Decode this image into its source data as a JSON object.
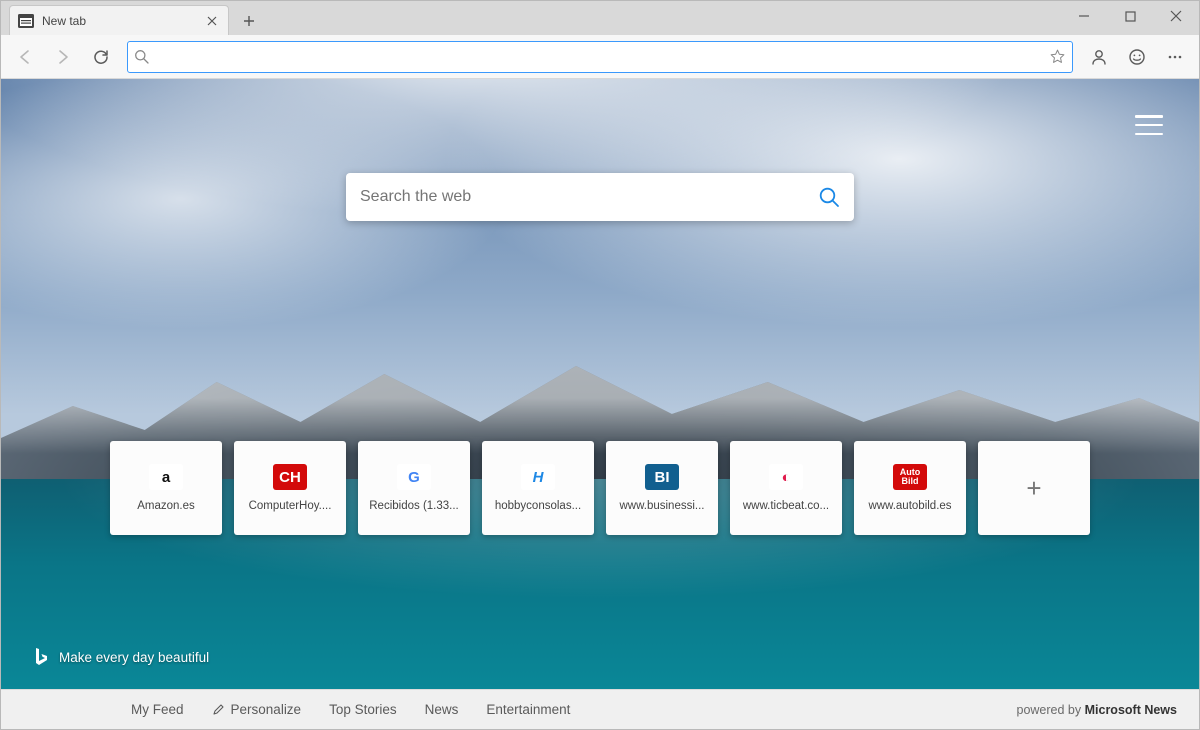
{
  "tab": {
    "title": "New tab"
  },
  "omnibox": {
    "placeholder": ""
  },
  "websearch": {
    "placeholder": "Search the web"
  },
  "tiles": [
    {
      "label": "Amazon.es",
      "icon_text": "a",
      "icon_bg": "#ffffff",
      "icon_fg": "#111111"
    },
    {
      "label": "ComputerHoy....",
      "icon_text": "CH",
      "icon_bg": "#d30a0a",
      "icon_fg": "#ffffff"
    },
    {
      "label": "Recibidos (1.33...",
      "icon_text": "G",
      "icon_bg": "#ffffff",
      "icon_fg": "#4285f4"
    },
    {
      "label": "hobbyconsolas...",
      "icon_text": "H",
      "icon_bg": "#ffffff",
      "icon_fg": "#1e88e5",
      "italic": true
    },
    {
      "label": "www.businessi...",
      "icon_text": "BI",
      "icon_bg": "#115f8f",
      "icon_fg": "#ffffff"
    },
    {
      "label": "www.ticbeat.co...",
      "icon_text": "◐",
      "icon_bg": "#ffffff",
      "icon_fg": "#e01b4c"
    },
    {
      "label": "www.autobild.es",
      "icon_text": "Auto\nBild",
      "icon_bg": "#d30a0a",
      "icon_fg": "#ffffff",
      "small": true
    }
  ],
  "bing_tagline": "Make every day beautiful",
  "bottom_nav": {
    "feed": "My Feed",
    "personalize": "Personalize",
    "top_stories": "Top Stories",
    "news": "News",
    "entertainment": "Entertainment",
    "powered_prefix": "powered by ",
    "powered_brand": "Microsoft News"
  }
}
